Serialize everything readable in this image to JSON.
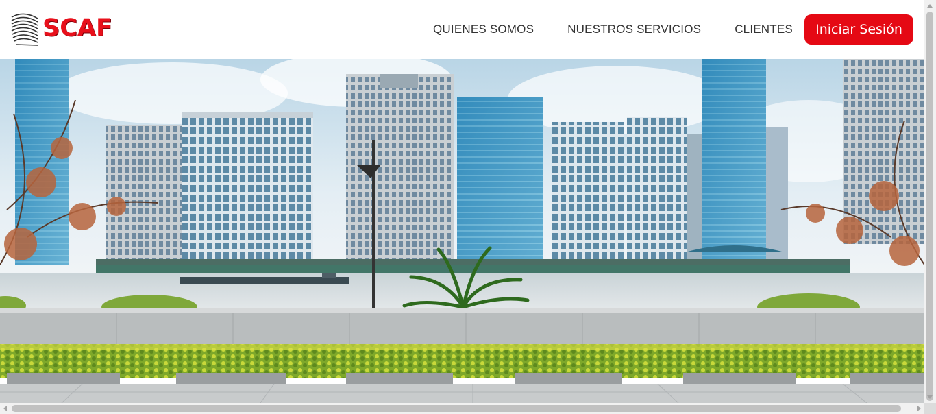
{
  "brand": {
    "name": "SCAF",
    "color": "#e8101b",
    "logo_icon": "building-stack-icon"
  },
  "nav": {
    "items": [
      {
        "label": "QUIENES SOMOS"
      },
      {
        "label": "NUESTROS SERVICIOS"
      },
      {
        "label": "CLIENTES"
      }
    ]
  },
  "header": {
    "login_label": "Iniciar Sesión",
    "login_color": "#e50914"
  },
  "hero": {
    "image": "city-skyline-riverfront-photo"
  }
}
